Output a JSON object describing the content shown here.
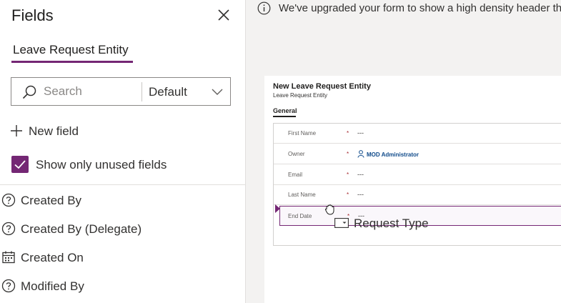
{
  "pane": {
    "title": "Fields",
    "tab": "Leave Request Entity",
    "search": {
      "placeholder": "Search",
      "filter_value": "Default"
    },
    "new_field_label": "New field",
    "show_unused_label": "Show only unused fields",
    "show_unused_checked": true,
    "fields": [
      {
        "label": "Created By",
        "icon": "help-circle-icon"
      },
      {
        "label": "Created By (Delegate)",
        "icon": "help-circle-icon"
      },
      {
        "label": "Created On",
        "icon": "calendar-icon"
      },
      {
        "label": "Modified By",
        "icon": "help-circle-icon"
      }
    ]
  },
  "banner": {
    "text": "We've upgraded your form to show a high density header th"
  },
  "form": {
    "title": "New Leave Request Entity",
    "subtitle": "Leave Request Entity",
    "tab": "General",
    "rows": [
      {
        "label": "First Name",
        "required": "*",
        "value": "---"
      },
      {
        "label": "Owner",
        "required": "*",
        "value": "MOD Administrator"
      },
      {
        "label": "Email",
        "required": "*",
        "value": "---"
      },
      {
        "label": "Last Name",
        "required": "*",
        "value": "---"
      },
      {
        "label": "End Date",
        "required": "*",
        "value": "---"
      }
    ]
  },
  "drag": {
    "label": "Request Type"
  },
  "colors": {
    "accent": "#742774",
    "link": "#0f4a8a",
    "required": "#a4262c"
  }
}
